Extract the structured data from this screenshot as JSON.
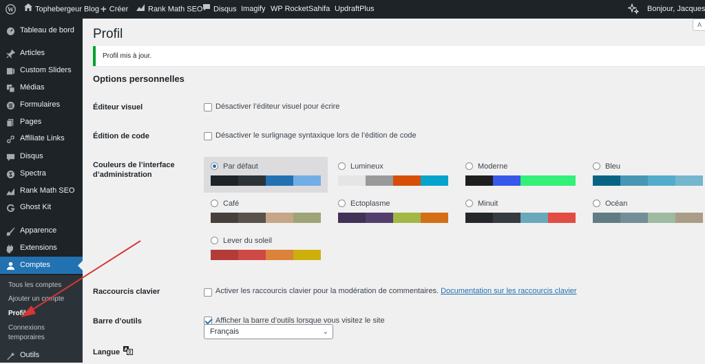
{
  "adminbar": {
    "site_name": "Tophebergeur Blog",
    "new_label": "Créer",
    "rankmath_label": "Rank Math SEO",
    "disqus_label": "Disqus",
    "imagify_label": "Imagify",
    "wprocket_label": "WP Rocket",
    "sahifa_label": "Sahifa",
    "updraft_label": "UpdraftPlus",
    "greeting": "Bonjour, Jacques Tre",
    "screen_options_label": "A"
  },
  "sidebar": {
    "items": [
      {
        "label": "Tableau de bord",
        "icon": "dashboard-icon"
      },
      {
        "label": "Articles",
        "icon": "pin-icon"
      },
      {
        "label": "Custom Sliders",
        "icon": "slides-icon"
      },
      {
        "label": "Médias",
        "icon": "media-icon"
      },
      {
        "label": "Formulaires",
        "icon": "forms-icon"
      },
      {
        "label": "Pages",
        "icon": "page-icon"
      },
      {
        "label": "Affiliate Links",
        "icon": "link-icon"
      },
      {
        "label": "Disqus",
        "icon": "comment-icon"
      },
      {
        "label": "Spectra",
        "icon": "spectra-icon"
      },
      {
        "label": "Rank Math SEO",
        "icon": "rankmath-icon"
      },
      {
        "label": "Ghost Kit",
        "icon": "ghostkit-icon"
      },
      {
        "label": "Apparence",
        "icon": "brush-icon"
      },
      {
        "label": "Extensions",
        "icon": "plugin-icon"
      },
      {
        "label": "Comptes",
        "icon": "users-icon"
      },
      {
        "label": "Outils",
        "icon": "tools-icon"
      }
    ],
    "submenu": [
      "Tous les comptes",
      "Ajouter un compte",
      "Profil",
      "Connexions temporaires"
    ]
  },
  "main": {
    "title": "Profil",
    "notice": "Profil mis à jour.",
    "section_title": "Options personnelles",
    "visual_editor": {
      "label": "Éditeur visuel",
      "text": "Désactiver l’éditeur visuel pour écrire",
      "checked": false
    },
    "code_editing": {
      "label": "Édition de code",
      "text": "Désactiver le surlignage syntaxique lors de l’édition de code",
      "checked": false
    },
    "color_scheme": {
      "label": "Couleurs de l’interface d’administration",
      "schemes": [
        {
          "name": "Par défaut",
          "colors": [
            "#1d2327",
            "#2c3338",
            "#2271b1",
            "#72aee6"
          ],
          "selected": true
        },
        {
          "name": "Lumineux",
          "colors": [
            "#e5e5e5",
            "#999999",
            "#d64e07",
            "#04a4cc"
          ],
          "selected": false
        },
        {
          "name": "Moderne",
          "colors": [
            "#1e1e1e",
            "#3858e9",
            "#33f078",
            "#33f078"
          ],
          "selected": false
        },
        {
          "name": "Bleu",
          "colors": [
            "#096484",
            "#4796b3",
            "#52accc",
            "#74b6ce"
          ],
          "selected": false
        },
        {
          "name": "Café",
          "colors": [
            "#46403c",
            "#59524c",
            "#c7a589",
            "#9ea476"
          ],
          "selected": false
        },
        {
          "name": "Ectoplasme",
          "colors": [
            "#413256",
            "#523f6d",
            "#a3b745",
            "#d46f15"
          ],
          "selected": false
        },
        {
          "name": "Minuit",
          "colors": [
            "#25282b",
            "#363b3f",
            "#69a8bb",
            "#e14d43"
          ],
          "selected": false
        },
        {
          "name": "Océan",
          "colors": [
            "#627c83",
            "#738e96",
            "#9ebaa0",
            "#aa9d88"
          ],
          "selected": false
        },
        {
          "name": "Lever du soleil",
          "colors": [
            "#b43c38",
            "#cf4944",
            "#dd823b",
            "#ccaf0b"
          ],
          "selected": false
        }
      ]
    },
    "shortcuts": {
      "label": "Raccourcis clavier",
      "text": "Activer les raccourcis clavier pour la modération de commentaires.",
      "link": "Documentation sur les raccourcis clavier",
      "checked": false
    },
    "toolbar": {
      "label": "Barre d’outils",
      "text": "Afficher la barre d’outils lorsque vous visitez le site",
      "checked": true
    },
    "language": {
      "label": "Langue",
      "value": "Français"
    }
  },
  "colors": {
    "accent": "#2271b1",
    "sidebar_bg": "#1d2327",
    "success": "#00a32a",
    "arrow": "#d63638"
  }
}
